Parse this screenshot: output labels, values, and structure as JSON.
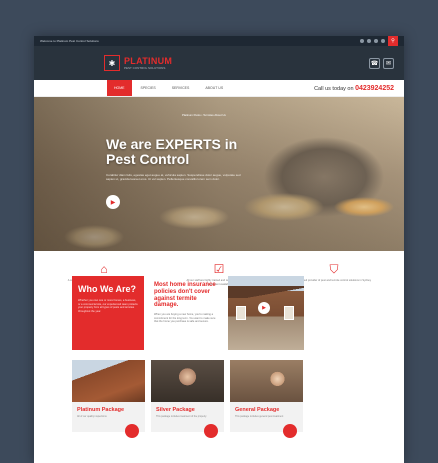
{
  "topbar": {
    "welcome": "Welcome to Platinum Pest Control Solutions",
    "search_icon": "search-icon",
    "social_icons": [
      "facebook-icon",
      "twitter-icon",
      "googleplus-icon",
      "linkedin-icon"
    ]
  },
  "header": {
    "logo_name": "PLATINUM",
    "logo_tag": "PEST CONTROL SOLUTIONS",
    "phone_icon": "☎",
    "mail_icon": "✉"
  },
  "nav": {
    "items": [
      {
        "label": "HOME",
        "active": true
      },
      {
        "label": "SPECIES",
        "active": false
      },
      {
        "label": "SERVICES",
        "active": false
      },
      {
        "label": "ABOUT US",
        "active": false
      }
    ],
    "call_label": "Call us today on",
    "call_number": "0423924252"
  },
  "hero": {
    "breadcrumb": "Platinum Pests • Termites About Us",
    "title_line1": "We are EXPERTS in",
    "title_line2": "Pest Control",
    "subtitle": "Curabitur diam felis, egestas eget augue at, vehicula sapien. Suspendisse dolor augue, vulputate sed sapien ut, gravida laoreet eros. Ut vel sapien. Pellentesque convallis lorem sem dolor.",
    "play_icon": "▶"
  },
  "features": [
    {
      "icon": "home-icon",
      "glyph": "⌂",
      "text": "A commercially dedicated and innovative approach to complete your control systems"
    },
    {
      "icon": "checkbox-icon",
      "glyph": "☑",
      "text": "All our staff are highly trained and certified with the latest equipment available"
    },
    {
      "icon": "shield-icon",
      "glyph": "⛉",
      "text": "A trusted provider of pest and termite control solutions in Sydney"
    }
  ],
  "who": {
    "title": "Who We Are?",
    "text": "Whether you own one or more homes, a business, or a commercial site, our experienced team protects your property from all types of pests and termites throughout the year."
  },
  "claim": {
    "title": "Most home insurance policies don't cover against termite damage.",
    "text": "When you are buying a new home, you're making a commitment for the long term. You want to make sure that the home you purchase is safe and secure."
  },
  "packages": [
    {
      "title": "Platinum Package",
      "text": "All of our quality inspections"
    },
    {
      "title": "Silver Package",
      "text": "This package includes treatment of the property"
    },
    {
      "title": "General Package",
      "text": "This package includes general pest treatment"
    }
  ]
}
